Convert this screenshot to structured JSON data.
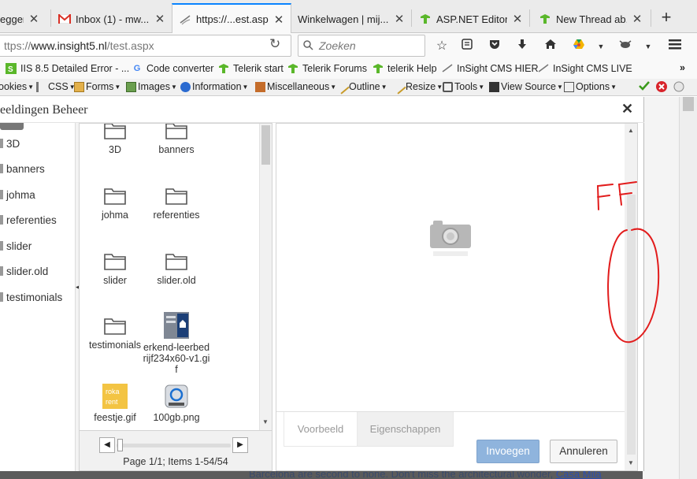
{
  "browser": {
    "tabs": [
      {
        "title": "egger",
        "favicon": "generic"
      },
      {
        "title": "Inbox (1) - mw...",
        "favicon": "gmail-icon"
      },
      {
        "title": "https://...est.aspx",
        "favicon": "page-icon"
      },
      {
        "title": "Winkelwagen | mij...",
        "favicon": "none"
      },
      {
        "title": "ASP.NET Editor...",
        "favicon": "telerik-icon"
      },
      {
        "title": "New Thread ab...",
        "favicon": "telerik-icon"
      }
    ],
    "url_prefix": "ttps://",
    "url_host": "www.insight5.nl",
    "url_path": "/test.aspx",
    "search_placeholder": "Zoeken",
    "bookmarks": [
      {
        "label": "IIS 8.5 Detailed Error - ..."
      },
      {
        "label": "Code converter"
      },
      {
        "label": "Telerik start"
      },
      {
        "label": "Telerik Forums"
      },
      {
        "label": "telerik Help"
      },
      {
        "label": "InSight CMS HIER"
      },
      {
        "label": "InSight CMS LIVE"
      }
    ],
    "devtools": [
      {
        "label": "ookies"
      },
      {
        "label": "CSS"
      },
      {
        "label": "Forms"
      },
      {
        "label": "Images"
      },
      {
        "label": "Information"
      },
      {
        "label": "Miscellaneous"
      },
      {
        "label": "Outline"
      },
      {
        "label": "Resize"
      },
      {
        "label": "Tools"
      },
      {
        "label": "View Source"
      },
      {
        "label": "Options"
      }
    ],
    "accent": "#0a84ff"
  },
  "modal": {
    "title": "eeldingen Beheer",
    "tree": [
      "3D",
      "banners",
      "johma",
      "referenties",
      "slider",
      "slider.old",
      "testimonials"
    ],
    "grid": [
      {
        "label": "3D",
        "type": "folder"
      },
      {
        "label": "banners",
        "type": "folder"
      },
      {
        "label": "johma",
        "type": "folder"
      },
      {
        "label": "referenties",
        "type": "folder"
      },
      {
        "label": "slider",
        "type": "folder"
      },
      {
        "label": "slider.old",
        "type": "folder"
      },
      {
        "label": "testimonials",
        "type": "folder"
      },
      {
        "label": "erkend-leerbedrijf234x60-v1.gif",
        "type": "image"
      },
      {
        "label": "feestje.gif",
        "type": "image"
      },
      {
        "label": "100gb.png",
        "type": "image"
      }
    ],
    "pager": "Page 1/1; Items 1-54/54",
    "preview_tabs": [
      "Voorbeeld",
      "Eigenschappen"
    ],
    "insert_label": "Invoegen",
    "cancel_label": "Annuleren",
    "annotation_text": "FF",
    "insert_color": "#8fb4dd"
  },
  "page_text": {
    "before": "Barcelona are second to none. Don't miss the architectural wonder, ",
    "link": "Casa Mila"
  }
}
